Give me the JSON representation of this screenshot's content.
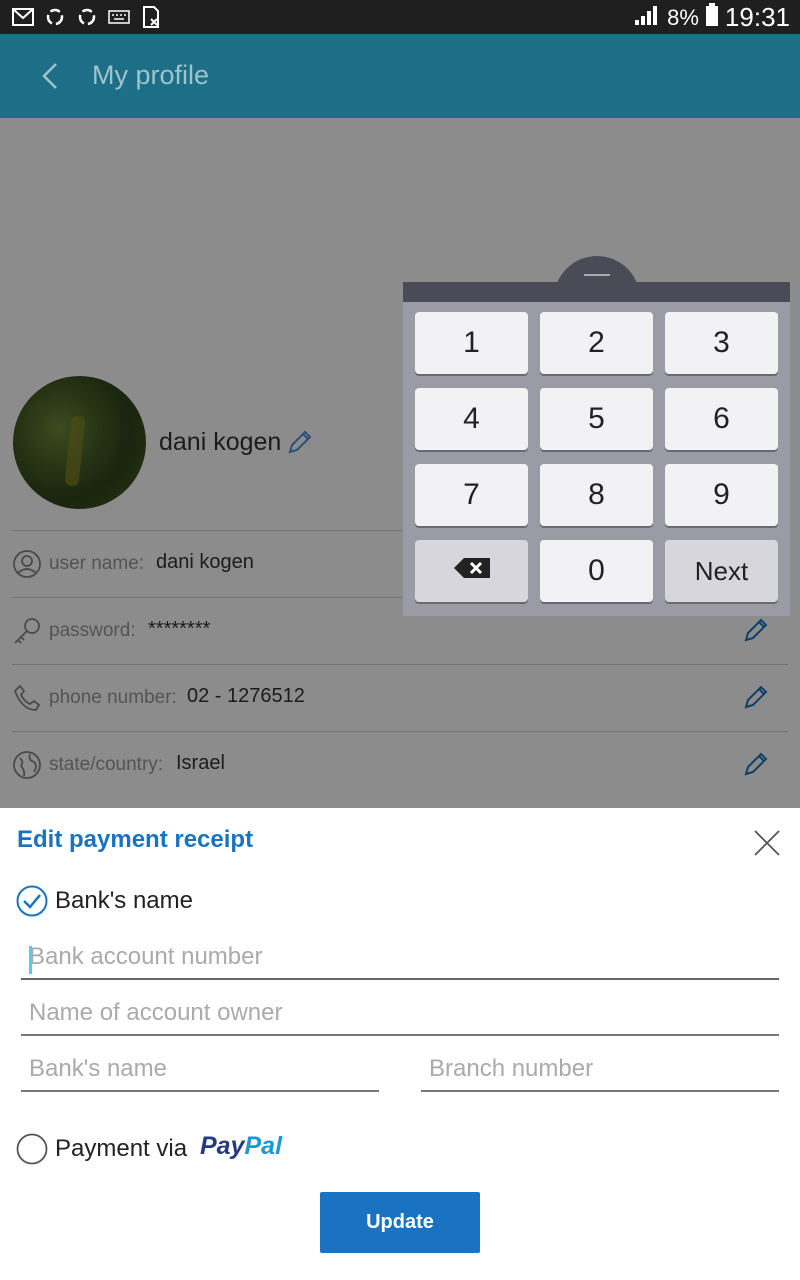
{
  "status_bar": {
    "battery_percent": "8%",
    "time": "19:31",
    "icons": [
      "gmail-icon",
      "sync-icon",
      "sync-icon",
      "keyboard-icon",
      "sim-off-icon",
      "signal-icon",
      "battery-icon"
    ]
  },
  "app_bar": {
    "title": "My profile"
  },
  "profile": {
    "display_name": "dani kogen",
    "rows": [
      {
        "label": "user name:",
        "value": "dani kogen",
        "icon": "user-icon"
      },
      {
        "label": "password:",
        "value": "********",
        "icon": "key-icon"
      },
      {
        "label": "phone number:",
        "value": "02 - 1276512",
        "icon": "phone-icon"
      },
      {
        "label": "state/country:",
        "value": "Israel",
        "icon": "globe-icon"
      }
    ]
  },
  "keypad": {
    "keys": [
      "1",
      "2",
      "3",
      "4",
      "5",
      "6",
      "7",
      "8",
      "9",
      "0"
    ],
    "next_label": "Next"
  },
  "payment_sheet": {
    "title": "Edit payment receipt",
    "bank_option_label": "Bank's name",
    "bank_option_selected": true,
    "fields": {
      "account_number_placeholder": "Bank account number",
      "account_owner_placeholder": "Name of account owner",
      "bank_name_placeholder": "Bank's name",
      "branch_number_placeholder": "Branch number"
    },
    "paypal_option_label": "Payment via",
    "paypal_logo": {
      "part1": "Pay",
      "part2": "Pal"
    },
    "paypal_option_selected": false,
    "update_label": "Update"
  },
  "colors": {
    "app_bar": "#1c6f86",
    "accent_blue": "#1a73c2",
    "edit_icon": "#1a73c2"
  }
}
